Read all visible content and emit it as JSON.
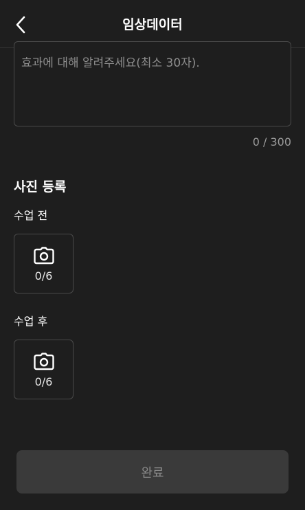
{
  "header": {
    "title": "임상데이터",
    "back_icon": "chevron-left-icon"
  },
  "description": {
    "placeholder": "효과에 대해 알려주세요(최소 30자).",
    "counter": "0 / 300"
  },
  "photo_section": {
    "title": "사진 등록",
    "before": {
      "label": "수업 전",
      "count": "0/6",
      "icon": "camera-icon"
    },
    "after": {
      "label": "수업 후",
      "count": "0/6",
      "icon": "camera-icon"
    }
  },
  "footer": {
    "done_label": "완료"
  },
  "colors": {
    "background": "#1e1e1e",
    "border": "#4a4a4a",
    "button_bg": "#3a3a3a",
    "button_text": "#8a8a8a"
  }
}
